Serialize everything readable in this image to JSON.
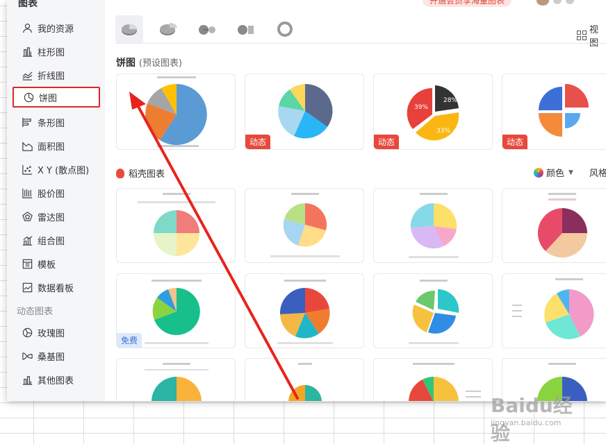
{
  "header": {
    "title": "图表",
    "promo": "开通会员享海量图表"
  },
  "sidebar": {
    "items": [
      {
        "label": "我的资源",
        "icon": "user-icon"
      },
      {
        "label": "柱形图",
        "icon": "bar-chart-icon"
      },
      {
        "label": "折线图",
        "icon": "line-chart-icon"
      },
      {
        "label": "饼图",
        "icon": "pie-chart-icon"
      },
      {
        "label": "条形图",
        "icon": "horizontal-bar-icon"
      },
      {
        "label": "面积图",
        "icon": "area-chart-icon"
      },
      {
        "label": "X Y (散点图)",
        "icon": "scatter-chart-icon"
      },
      {
        "label": "股价图",
        "icon": "stock-chart-icon"
      },
      {
        "label": "雷达图",
        "icon": "radar-chart-icon"
      },
      {
        "label": "组合图",
        "icon": "combo-chart-icon"
      },
      {
        "label": "模板",
        "icon": "template-icon"
      },
      {
        "label": "数据看板",
        "icon": "dashboard-icon"
      }
    ],
    "section2": "动态图表",
    "items2": [
      {
        "label": "玫瑰图",
        "icon": "rose-chart-icon"
      },
      {
        "label": "桑基图",
        "icon": "sankey-chart-icon"
      },
      {
        "label": "其他图表",
        "icon": "other-chart-icon"
      }
    ]
  },
  "toolbar": {
    "view_label": "视图"
  },
  "preset": {
    "title": "饼图",
    "subtitle": "(预设图表)",
    "badge": "动态",
    "labels": {
      "a": "39%",
      "b": "28%",
      "c": "33%"
    }
  },
  "gallery": {
    "title": "稻壳图表",
    "color_label": "颜色",
    "style_label": "风格",
    "free_badge": "免费"
  },
  "watermark": {
    "logo": "Baidu经验",
    "url": "jingyan.baidu.com"
  }
}
